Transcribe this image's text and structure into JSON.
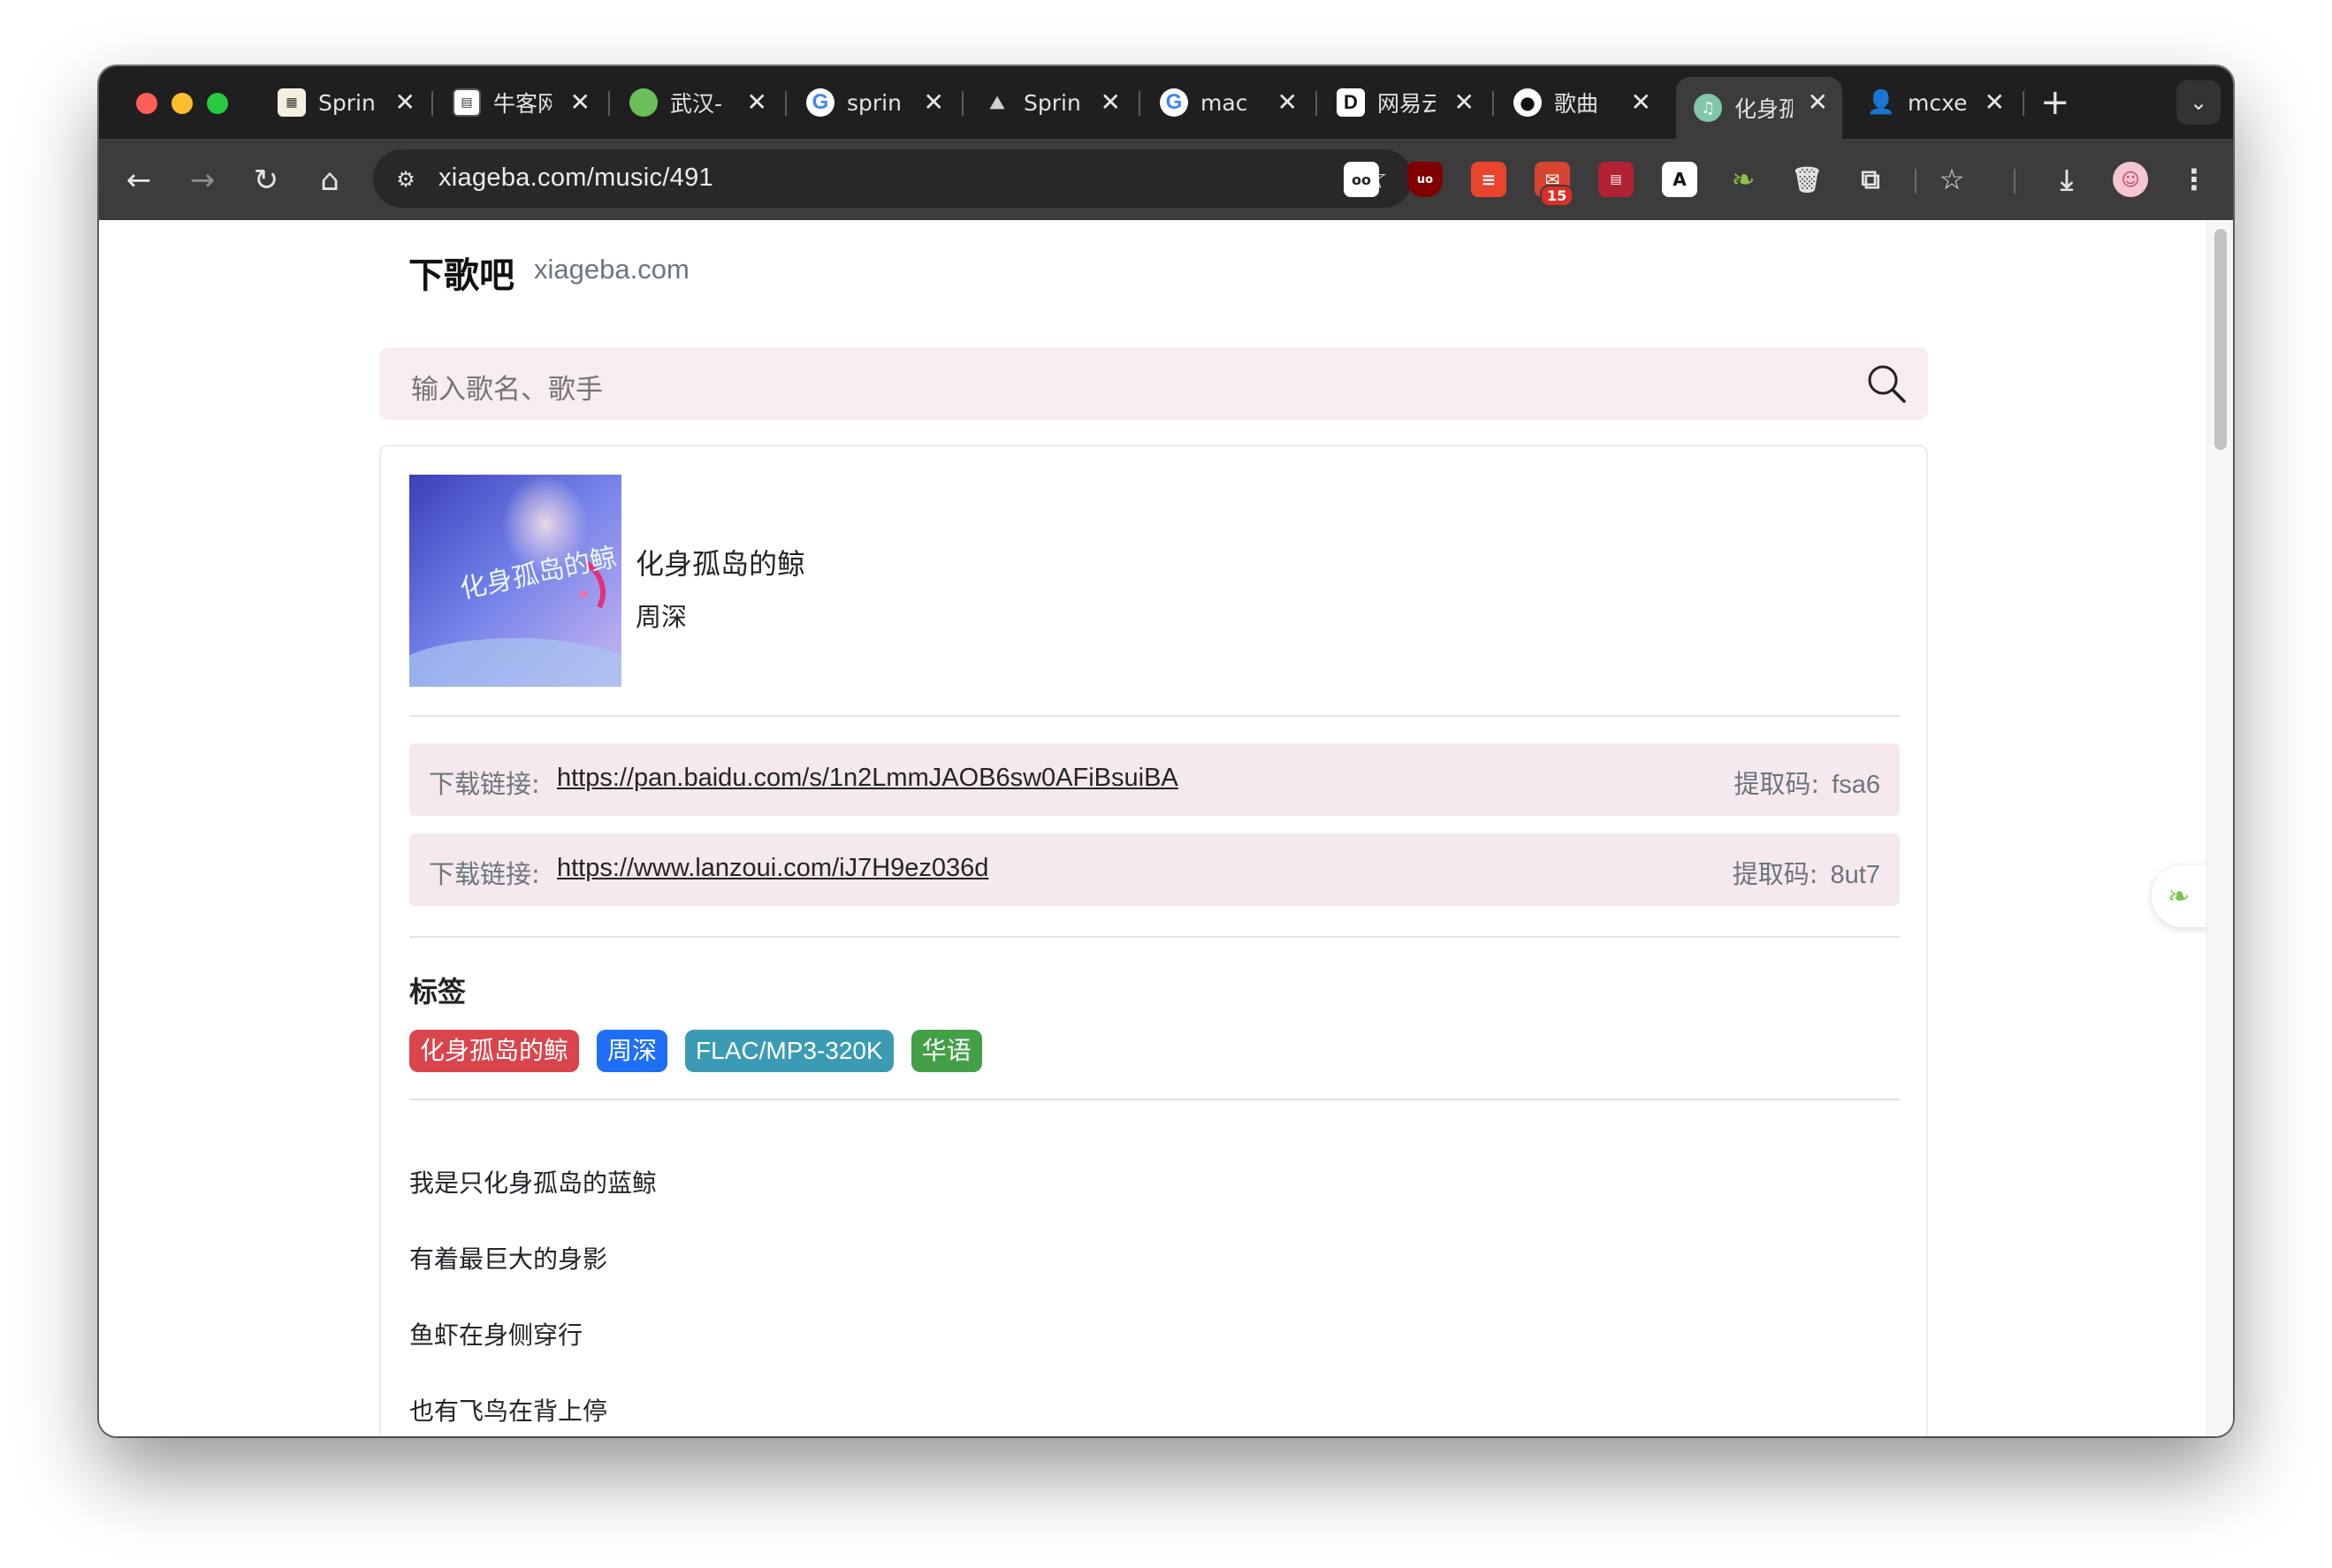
{
  "browser": {
    "tabs": [
      {
        "title": "Sprin",
        "favicon": "spring-doc-icon",
        "active": false
      },
      {
        "title": "牛客网",
        "favicon": "nowcoder-icon",
        "active": false
      },
      {
        "title": "武汉-",
        "favicon": "leaf-icon",
        "active": false
      },
      {
        "title": "sprin",
        "favicon": "google-icon",
        "active": false
      },
      {
        "title": "Sprin",
        "favicon": "spring-icon",
        "active": false
      },
      {
        "title": "mac",
        "favicon": "google-icon",
        "active": false
      },
      {
        "title": "网易云",
        "favicon": "d-icon",
        "active": false
      },
      {
        "title": "歌曲",
        "favicon": "github-icon",
        "active": false
      },
      {
        "title": "化身孤",
        "favicon": "music-icon",
        "active": true
      },
      {
        "title": "mcxe",
        "favicon": "person-icon",
        "active": false
      }
    ],
    "new_tab": "+",
    "address": "xiageba.com/music/491",
    "extension_badge": "15"
  },
  "site": {
    "brand": "下歌吧",
    "domain": "xiageba.com",
    "search_placeholder": "输入歌名、歌手"
  },
  "song": {
    "title": "化身孤岛的鲸",
    "artist": "周深",
    "cover_text": "化身孤岛的鲸"
  },
  "downloads": [
    {
      "label": "下载链接:",
      "url": "https://pan.baidu.com/s/1n2LmmJAOB6sw0AFiBsuiBA",
      "code_label": "提取码:",
      "code": "fsa6"
    },
    {
      "label": "下载链接:",
      "url": "https://www.lanzoui.com/iJ7H9ez036d",
      "code_label": "提取码:",
      "code": "8ut7"
    }
  ],
  "tags": {
    "title": "标签",
    "items": [
      {
        "text": "化身孤岛的鲸",
        "color": "#d9454b"
      },
      {
        "text": "周深",
        "color": "#1e6ff5"
      },
      {
        "text": "FLAC/MP3-320K",
        "color": "#3b9bb4"
      },
      {
        "text": "华语",
        "color": "#43a047"
      }
    ]
  },
  "lyrics": [
    "我是只化身孤岛的蓝鲸",
    "有着最巨大的身影",
    "鱼虾在身侧穿行",
    "也有飞鸟在背上停"
  ],
  "colors": {
    "tab_strip": "#1f1f1f",
    "toolbar": "#3c3c3c",
    "search_bg": "#f7ecf0",
    "download_bg": "#f5e9ed"
  }
}
